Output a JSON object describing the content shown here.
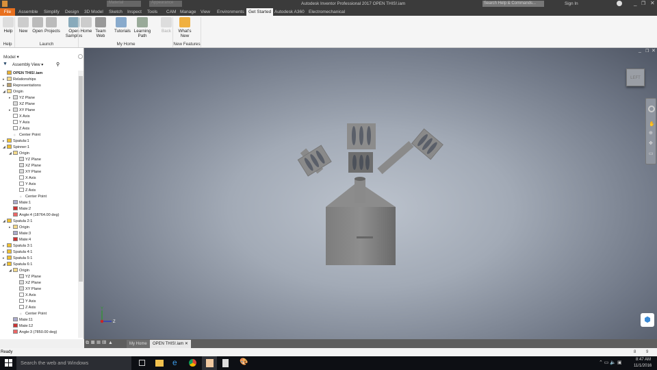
{
  "title_bar": {
    "title": "Autodesk Inventor Professional 2017    OPEN THIS!.iam",
    "material_placeholder": "Material",
    "appearance_placeholder": "Appearance",
    "search_placeholder": "Search Help & Commands...",
    "sign_in": "Sign In"
  },
  "ribbon_tabs": [
    "File",
    "Assemble",
    "Simplify",
    "Design",
    "3D Model",
    "Sketch",
    "Inspect",
    "Tools",
    "CAM",
    "Manage",
    "View",
    "Environments",
    "Get Started",
    "Autodesk A360",
    "Electromechanical"
  ],
  "ribbon": {
    "buttons": [
      {
        "label": "Help"
      },
      {
        "label": "New"
      },
      {
        "label": "Open"
      },
      {
        "label": "Projects"
      },
      {
        "label": "Open Samples"
      },
      {
        "label": "Home"
      },
      {
        "label": "Team Web"
      },
      {
        "label": "Tutorials"
      },
      {
        "label": "Learning Path"
      },
      {
        "label": "Back"
      },
      {
        "label": "What's New"
      }
    ],
    "groups": [
      "Help",
      "Launch",
      "My Home",
      "New Features"
    ]
  },
  "browser": {
    "title": "Model",
    "view": "Assembly View",
    "items": [
      {
        "label": "OPEN THIS!.iam",
        "level": 0,
        "ex": "",
        "icon": "assembly"
      },
      {
        "label": "Relationships",
        "level": 0,
        "ex": "▸",
        "icon": "folder"
      },
      {
        "label": "Representations",
        "level": 0,
        "ex": "▸",
        "icon": "rep"
      },
      {
        "label": "Origin",
        "level": 0,
        "ex": "◢",
        "icon": "folder"
      },
      {
        "label": "YZ Plane",
        "level": 1,
        "ex": "▸",
        "icon": "plane"
      },
      {
        "label": "XZ Plane",
        "level": 1,
        "ex": "",
        "icon": "plane"
      },
      {
        "label": "XY Plane",
        "level": 1,
        "ex": "▸",
        "icon": "plane"
      },
      {
        "label": "X Axis",
        "level": 1,
        "ex": "",
        "icon": "axis"
      },
      {
        "label": "Y Axis",
        "level": 1,
        "ex": "",
        "icon": "axis"
      },
      {
        "label": "Z Axis",
        "level": 1,
        "ex": "",
        "icon": "axis"
      },
      {
        "label": "Center Point",
        "level": 1,
        "ex": "",
        "icon": "point"
      },
      {
        "label": "Spatula:1",
        "level": 0,
        "ex": "▸",
        "icon": "part"
      },
      {
        "label": "Spinner:1",
        "level": 0,
        "ex": "◢",
        "icon": "part"
      },
      {
        "label": "Origin",
        "level": 1,
        "ex": "◢",
        "icon": "folder"
      },
      {
        "label": "YZ Plane",
        "level": 2,
        "ex": "",
        "icon": "plane"
      },
      {
        "label": "XZ Plane",
        "level": 2,
        "ex": "",
        "icon": "plane"
      },
      {
        "label": "XY Plane",
        "level": 2,
        "ex": "",
        "icon": "plane"
      },
      {
        "label": "X Axis",
        "level": 2,
        "ex": "",
        "icon": "axis"
      },
      {
        "label": "Y Axis",
        "level": 2,
        "ex": "",
        "icon": "axis"
      },
      {
        "label": "Z Axis",
        "level": 2,
        "ex": "",
        "icon": "axis"
      },
      {
        "label": "Center Point",
        "level": 2,
        "ex": "",
        "icon": "point"
      },
      {
        "label": "Mate:1",
        "level": 1,
        "ex": "",
        "icon": "mate"
      },
      {
        "label": "Mate:2",
        "level": 1,
        "ex": "",
        "icon": "mate-red"
      },
      {
        "label": "Angle:4 (18764.00 deg)",
        "level": 1,
        "ex": "",
        "icon": "angle"
      },
      {
        "label": "Spatula 2:1",
        "level": 0,
        "ex": "◢",
        "icon": "part"
      },
      {
        "label": "Origin",
        "level": 1,
        "ex": "▸",
        "icon": "folder"
      },
      {
        "label": "Mate:3",
        "level": 1,
        "ex": "",
        "icon": "mate"
      },
      {
        "label": "Mate:4",
        "level": 1,
        "ex": "",
        "icon": "mate-red"
      },
      {
        "label": "Spatula 3:1",
        "level": 0,
        "ex": "▸",
        "icon": "part"
      },
      {
        "label": "Spatula 4:1",
        "level": 0,
        "ex": "▸",
        "icon": "part"
      },
      {
        "label": "Spatula 5:1",
        "level": 0,
        "ex": "▸",
        "icon": "part"
      },
      {
        "label": "Spatula 6:1",
        "level": 0,
        "ex": "◢",
        "icon": "part"
      },
      {
        "label": "Origin",
        "level": 1,
        "ex": "◢",
        "icon": "folder"
      },
      {
        "label": "YZ Plane",
        "level": 2,
        "ex": "",
        "icon": "plane"
      },
      {
        "label": "XZ Plane",
        "level": 2,
        "ex": "",
        "icon": "plane"
      },
      {
        "label": "XY Plane",
        "level": 2,
        "ex": "",
        "icon": "plane"
      },
      {
        "label": "X Axis",
        "level": 2,
        "ex": "",
        "icon": "axis"
      },
      {
        "label": "Y Axis",
        "level": 2,
        "ex": "",
        "icon": "axis"
      },
      {
        "label": "Z Axis",
        "level": 2,
        "ex": "",
        "icon": "axis"
      },
      {
        "label": "Center Point",
        "level": 2,
        "ex": "",
        "icon": "point"
      },
      {
        "label": "Mate:11",
        "level": 1,
        "ex": "",
        "icon": "mate"
      },
      {
        "label": "Mate:12",
        "level": 1,
        "ex": "",
        "icon": "mate-red"
      },
      {
        "label": "Angle:3 (7850.00 deg)",
        "level": 1,
        "ex": "",
        "icon": "angle"
      }
    ]
  },
  "viewcube": {
    "face": "LEFT"
  },
  "axis_labels": {
    "y": "Y",
    "z": "Z"
  },
  "doc_tabs": [
    "My Home",
    "OPEN THIS!.iam"
  ],
  "status": {
    "text": "Ready",
    "count1": "8",
    "count2": "9"
  },
  "taskbar": {
    "search": "Search the web and Windows",
    "time": "8:47 AM",
    "date": "11/1/2016"
  }
}
